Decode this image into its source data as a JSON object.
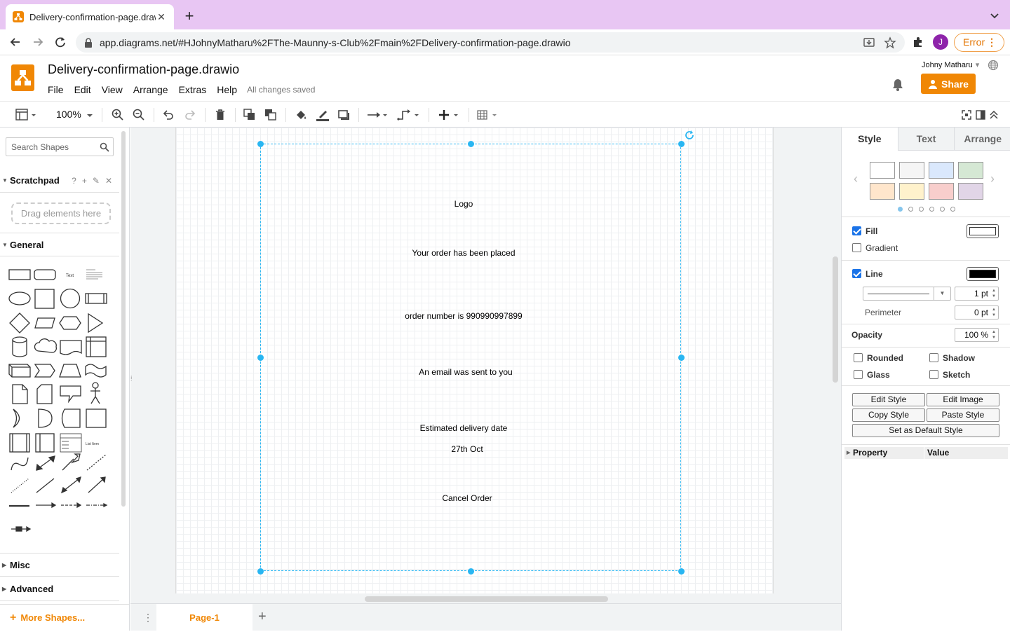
{
  "browser": {
    "tab_title": "Delivery-confirmation-page.drawio",
    "url": "app.diagrams.net/#HJohnyMatharu%2FThe-Maunny-s-Club%2Fmain%2FDelivery-confirmation-page.drawio",
    "avatar_initial": "J",
    "error_label": "Error"
  },
  "app": {
    "doc_title": "Delivery-confirmation-page.drawio",
    "menu": [
      "File",
      "Edit",
      "View",
      "Arrange",
      "Extras",
      "Help"
    ],
    "save_status": "All changes saved",
    "user_name": "Johny Matharu",
    "share_label": "Share",
    "accent_color": "#f08705"
  },
  "toolbar": {
    "zoom": "100%"
  },
  "left_panel": {
    "search_placeholder": "Search Shapes",
    "scratchpad_title": "Scratchpad",
    "scratchpad_drop": "Drag elements here",
    "general_title": "General",
    "misc_title": "Misc",
    "advanced_title": "Advanced",
    "more_shapes": "More Shapes..."
  },
  "diagram": {
    "texts": [
      "Logo",
      "Your order has been placed",
      "order number is 990990997899",
      "An email was sent to you",
      "Estimated delivery date",
      "27th Oct",
      "Cancel Order"
    ],
    "selection_color": "#29b6f2"
  },
  "pages": {
    "tabs": [
      "Page-1"
    ]
  },
  "right_panel": {
    "tabs": [
      "Style",
      "Text",
      "Arrange"
    ],
    "swatches": [
      "#ffffff",
      "#f5f5f5",
      "#dae8fc",
      "#d5e8d4",
      "#ffe6cc",
      "#fff2cc",
      "#f8cecc",
      "#e1d5e7"
    ],
    "fill_label": "Fill",
    "gradient_label": "Gradient",
    "line_label": "Line",
    "line_width": "1 pt",
    "perimeter_label": "Perimeter",
    "perimeter_value": "0 pt",
    "opacity_label": "Opacity",
    "opacity_value": "100 %",
    "rounded_label": "Rounded",
    "shadow_label": "Shadow",
    "glass_label": "Glass",
    "sketch_label": "Sketch",
    "edit_style": "Edit Style",
    "edit_image": "Edit Image",
    "copy_style": "Copy Style",
    "paste_style": "Paste Style",
    "set_default": "Set as Default Style",
    "property_header": "Property",
    "value_header": "Value"
  }
}
